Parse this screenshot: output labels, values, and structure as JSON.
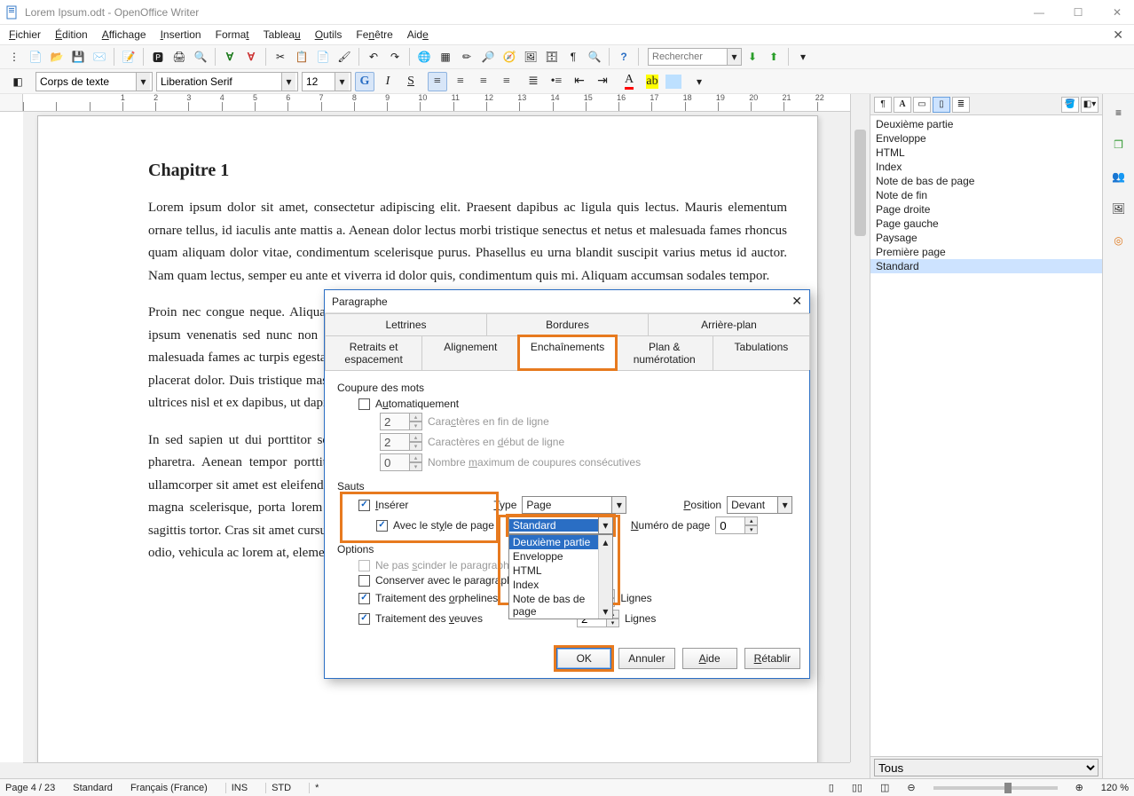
{
  "window": {
    "title": "Lorem Ipsum.odt - OpenOffice Writer"
  },
  "menu": [
    "Fichier",
    "Édition",
    "Affichage",
    "Insertion",
    "Format",
    "Tableau",
    "Outils",
    "Fenêtre",
    "Aide"
  ],
  "search_placeholder": "Rechercher",
  "fmt": {
    "paragraph_style": "Corps de texte",
    "font_name": "Liberation Serif",
    "font_size": "12"
  },
  "doc": {
    "heading": "Chapitre 1",
    "p1": "Lorem ipsum dolor sit amet, consectetur adipiscing elit. Praesent dapibus ac ligula quis lectus. Mauris elementum ornare tellus, id iaculis ante mattis a. Aenean dolor lectus morbi tristique senectus et netus et malesuada fames rhoncus quam aliquam dolor vitae, condimentum scelerisque purus. Phasellus eu urna blandit suscipit varius metus id auctor. Nam quam lectus, semper eu ante et viverra id dolor quis, condimentum quis mi. Aliquam accumsan sodales tempor.",
    "p2": "Proin nec congue neque. Aliquam porttitor pharetra enim, id elementum leo consequat. Quisque sollicitudin erat et ipsum venenatis sed nunc non quam ornare accumsan sit amet id velit. Pellentesque habitant morbi tristique eget malesuada fames ac turpis egestas. Donec vitae sem sed nisl posuere porta tortor. Ut vel neque facilisis, maximus elit a placerat dolor. Duis tristique massa elit, cursus sollicitudin eros convallis a. Nam volutpat turpis suscipit imperdiet. In ultrices nisl et ex dapibus, ut dapibus arcu consectetur ullamcorper. Quisque eget erat et ipsum venenatis scelerisque.",
    "p3": "In sed sapien ut dui porttitor sodales sed ac risus. Phasellus dictum lacus at neque dignissim, vitae tempus nulla pharetra. Aenean tempor porttitor tincidunt. Cras urna diam, iaculis vel tempor vitae, laoreet eget ligula. Nam ullamcorper sit amet est eleifend tristique. Proin est velit, malesuada non lobortis et, accumsan non dui. Suspendisse at magna scelerisque, porta lorem vulputate, porta turpis. Morbi tellus urna, ultricies et ante condimentum, faucibus sagittis tortor. Cras sit amet cursus ex. Interdum et malesuada fames ac ante ipsum primis in faucibus. Vestibulum tortor odio, vehicula ac lorem at, elementum dapibus eros."
  },
  "styles": {
    "items": [
      "Deuxième partie",
      "Enveloppe",
      "HTML",
      "Index",
      "Note de bas de page",
      "Note de fin",
      "Page droite",
      "Page gauche",
      "Paysage",
      "Première page",
      "Standard"
    ],
    "selected": "Standard",
    "filter": "Tous"
  },
  "dialog": {
    "title": "Paragraphe",
    "tabs_top": [
      "Lettrines",
      "Bordures",
      "Arrière-plan"
    ],
    "tabs_bottom": [
      "Retraits et espacement",
      "Alignement",
      "Enchaînements",
      "Plan & numérotation",
      "Tabulations"
    ],
    "active_tab": "Enchaînements",
    "hyphen": {
      "group": "Coupure des mots",
      "auto": "Automatiquement",
      "end_chars_val": "2",
      "end_chars_lbl": "Caractères en fin de ligne",
      "start_chars_val": "2",
      "start_chars_lbl": "Caractères en début de ligne",
      "max_val": "0",
      "max_lbl": "Nombre maximum de coupures consécutives"
    },
    "breaks": {
      "group": "Sauts",
      "insert": "Insérer",
      "type_lbl": "Type",
      "type_val": "Page",
      "pos_lbl": "Position",
      "pos_val": "Devant",
      "with_style": "Avec le style de page",
      "style_val": "Standard",
      "dd_options": [
        "Deuxième partie",
        "Enveloppe",
        "HTML",
        "Index",
        "Note de bas de page"
      ],
      "pageno_lbl": "Numéro de page",
      "pageno_val": "0"
    },
    "options": {
      "group": "Options",
      "no_split": "Ne pas scinder le paragraphe",
      "keep_next": "Conserver avec le paragraphe suivant",
      "orphan": "Traitement des orphelines",
      "orphan_val": "2",
      "orphan_unit": "Lignes",
      "widow": "Traitement des veuves",
      "widow_val": "2",
      "widow_unit": "Lignes"
    },
    "buttons": {
      "ok": "OK",
      "cancel": "Annuler",
      "help": "Aide",
      "reset": "Rétablir"
    }
  },
  "status": {
    "page": "Page 4 / 23",
    "style": "Standard",
    "lang": "Français (France)",
    "ins": "INS",
    "std": "STD",
    "mod": "*",
    "zoom": "120 %"
  }
}
